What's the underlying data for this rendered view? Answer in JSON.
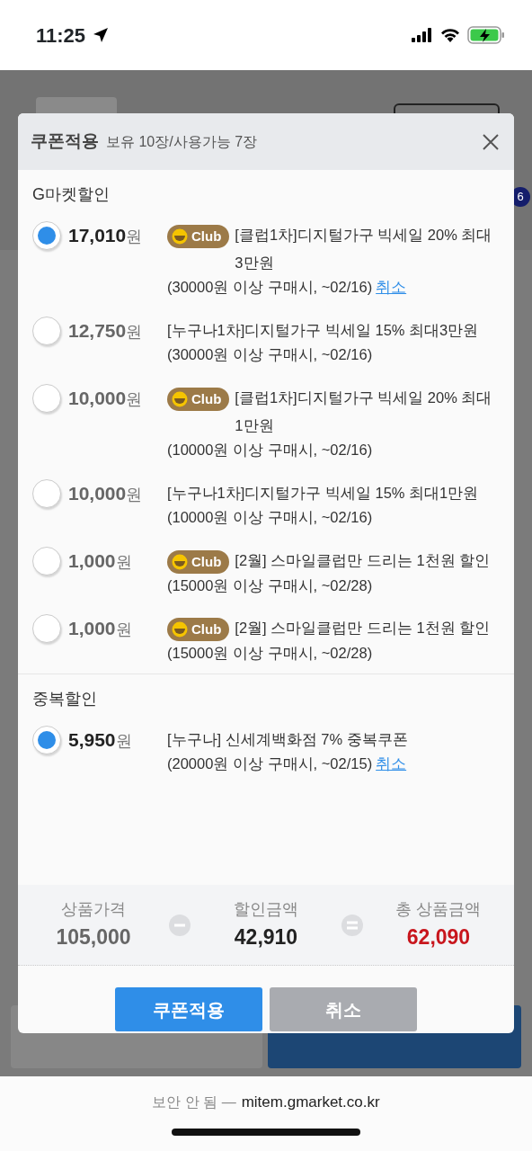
{
  "status_bar": {
    "time": "11:25"
  },
  "background": {
    "badge": "6"
  },
  "modal": {
    "title": "쿠폰적용",
    "subtitle": "보유 10장/사용가능 7장",
    "sections": [
      {
        "title": "G마켓할인",
        "coupons": [
          {
            "amount": "17,010",
            "unit": "원",
            "selected": true,
            "badge": "Club",
            "description": "[클럽1차]디지털가구 빅세일 20% 최대3만원",
            "condition": "(30000원 이상 구매시, ~02/16)",
            "cancel": "취소"
          },
          {
            "amount": "12,750",
            "unit": "원",
            "selected": false,
            "description": "[누구나1차]디지털가구 빅세일 15% 최대3만원",
            "condition": "(30000원 이상 구매시, ~02/16)"
          },
          {
            "amount": "10,000",
            "unit": "원",
            "selected": false,
            "badge": "Club",
            "description": "[클럽1차]디지털가구 빅세일 20% 최대1만원",
            "condition": "(10000원 이상 구매시, ~02/16)"
          },
          {
            "amount": "10,000",
            "unit": "원",
            "selected": false,
            "description": "[누구나1차]디지털가구 빅세일 15% 최대1만원",
            "condition": "(10000원 이상 구매시, ~02/16)"
          },
          {
            "amount": "1,000",
            "unit": "원",
            "selected": false,
            "badge": "Club",
            "description": "[2월] 스마일클럽만 드리는 1천원 할인",
            "condition": "(15000원 이상 구매시, ~02/28)"
          },
          {
            "amount": "1,000",
            "unit": "원",
            "selected": false,
            "badge": "Club",
            "description": "[2월] 스마일클럽만 드리는 1천원 할인",
            "condition": "(15000원 이상 구매시, ~02/28)"
          }
        ]
      },
      {
        "title": "중복할인",
        "coupons": [
          {
            "amount": "5,950",
            "unit": "원",
            "selected": true,
            "description": "[누구나] 신세계백화점 7% 중복쿠폰",
            "condition": "(20000원 이상 구매시, ~02/15)",
            "cancel": "취소"
          }
        ]
      }
    ],
    "summary": [
      {
        "label": "상품가격",
        "value": "105,000",
        "kind": "price"
      },
      {
        "label": "할인금액",
        "value": "42,910",
        "kind": "discount"
      },
      {
        "label": "총 상품금액",
        "value": "62,090",
        "kind": "total"
      }
    ],
    "buttons": [
      {
        "label": "쿠폰적용",
        "kind": "primary"
      },
      {
        "label": "취소",
        "kind": "secondary"
      }
    ]
  },
  "browser_bar": {
    "security": "보안 안 됨 —",
    "domain": "mitem.gmarket.co.kr"
  }
}
